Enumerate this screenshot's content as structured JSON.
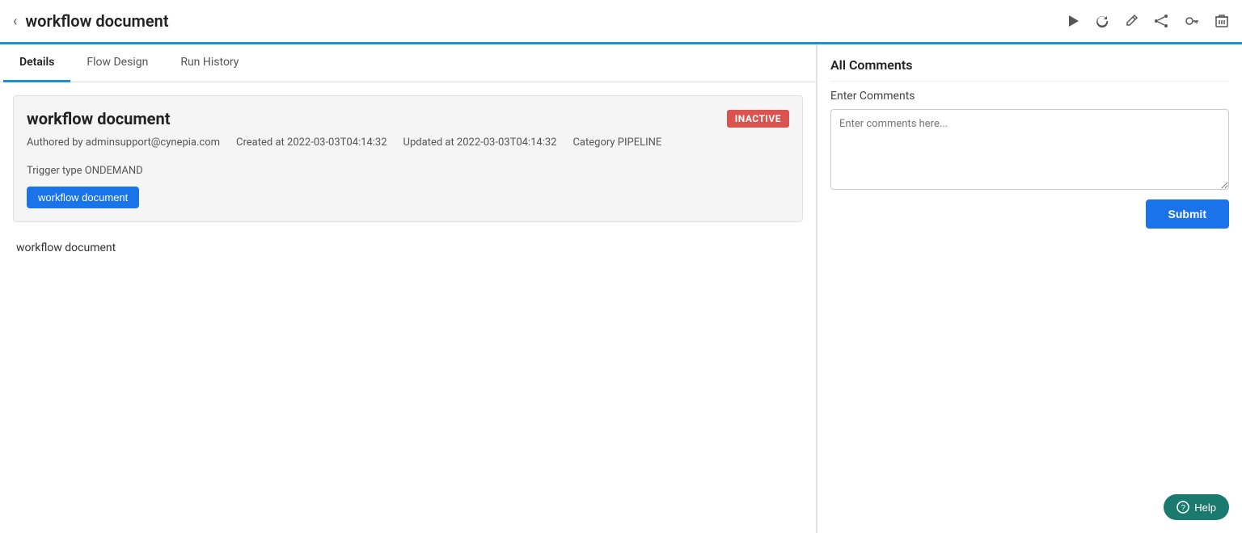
{
  "header": {
    "back_label": "‹",
    "title": "workflow document",
    "icons": {
      "run": "▶",
      "refresh": "↻",
      "edit": "✎",
      "share": "⌥",
      "key": "⚿",
      "delete": "🗑"
    }
  },
  "tabs": [
    {
      "id": "details",
      "label": "Details",
      "active": true
    },
    {
      "id": "flow-design",
      "label": "Flow Design",
      "active": false
    },
    {
      "id": "run-history",
      "label": "Run History",
      "active": false
    }
  ],
  "workflow": {
    "name": "workflow document",
    "status": "INACTIVE",
    "meta": {
      "authored_by_label": "Authored by",
      "author": "adminsupport@cynepia.com",
      "created_at_label": "Created at",
      "created_at": "2022-03-03T04:14:32",
      "updated_at_label": "Updated at",
      "updated_at": "2022-03-03T04:14:32",
      "category_label": "Category",
      "category": "PIPELINE",
      "trigger_type_label": "Trigger type",
      "trigger_type": "ONDEMAND"
    },
    "tag_button": "workflow document",
    "description": "workflow document"
  },
  "comments": {
    "section_title": "All Comments",
    "input_label": "Enter Comments",
    "placeholder": "Enter comments here...",
    "submit_label": "Submit"
  },
  "help": {
    "label": "Help"
  }
}
